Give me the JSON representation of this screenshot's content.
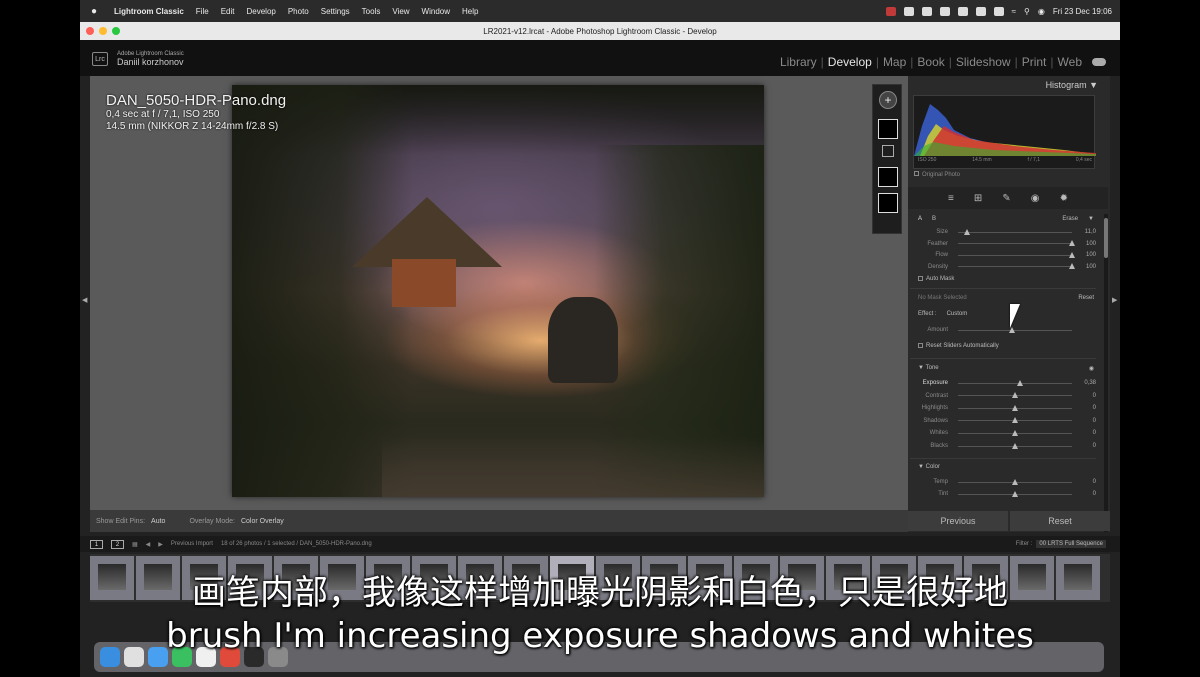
{
  "menubar": {
    "app": "Lightroom Classic",
    "items": [
      "File",
      "Edit",
      "Develop",
      "Photo",
      "Settings",
      "Tools",
      "View",
      "Window",
      "Help"
    ],
    "clock": "Fri 23 Dec  19:06"
  },
  "window": {
    "title": "LR2021-v12.lrcat - Adobe Photoshop Lightroom Classic - Develop"
  },
  "identity": {
    "product": "Adobe Lightroom Classic",
    "user": "Daniil korzhonov",
    "logo": "Lrc"
  },
  "modules": [
    "Library",
    "Develop",
    "Map",
    "Book",
    "Slideshow",
    "Print",
    "Web"
  ],
  "active_module": "Develop",
  "photo": {
    "filename": "DAN_5050-HDR-Pano.dng",
    "exposure": "0,4 sec at f / 7,1, ISO 250",
    "lens": "14.5 mm (NIKKOR Z 14-24mm f/2.8 S)"
  },
  "toolbar": {
    "show_pins_label": "Show Edit Pins:",
    "show_pins_value": "Auto",
    "overlay_label": "Overlay Mode:",
    "overlay_value": "Color Overlay"
  },
  "panel": {
    "histogram_title": "Histogram",
    "histo_labels": [
      "ISO 250",
      "14.5 mm",
      "f / 7,1",
      "0,4 sec"
    ],
    "original_photo": "Original Photo",
    "brush": {
      "tabs": [
        "A",
        "B"
      ],
      "erase": "Erase",
      "sliders": [
        {
          "label": "Size",
          "value": "11,0",
          "pos": 0.08
        },
        {
          "label": "Feather",
          "value": "100",
          "pos": 1.0
        },
        {
          "label": "Flow",
          "value": "100",
          "pos": 1.0
        },
        {
          "label": "Density",
          "value": "100",
          "pos": 1.0
        }
      ],
      "auto_mask": "Auto Mask"
    },
    "mask": {
      "none_selected": "No Mask Selected",
      "reset": "Reset",
      "effect_label": "Effect :",
      "effect_value": "Custom",
      "amount": "Amount",
      "reset_sliders": "Reset Sliders Automatically"
    },
    "tone": {
      "title": "Tone",
      "sliders": [
        {
          "label": "Exposure",
          "value": "0,38",
          "pos": 0.54,
          "bold": true
        },
        {
          "label": "Contrast",
          "value": "0",
          "pos": 0.5
        },
        {
          "label": "Highlights",
          "value": "0",
          "pos": 0.5
        },
        {
          "label": "Shadows",
          "value": "0",
          "pos": 0.5
        },
        {
          "label": "Whites",
          "value": "0",
          "pos": 0.5
        },
        {
          "label": "Blacks",
          "value": "0",
          "pos": 0.5
        }
      ]
    },
    "color": {
      "title": "Color",
      "sliders": [
        {
          "label": "Temp",
          "value": "0",
          "pos": 0.5
        },
        {
          "label": "Tint",
          "value": "0",
          "pos": 0.5
        }
      ]
    },
    "previous": "Previous",
    "reset": "Reset"
  },
  "filmstrip": {
    "pages": [
      "1",
      "2"
    ],
    "source": "Previous Import",
    "count": "18 of 26 photos / 1 selected / DAN_5050-HDR-Pano.dng",
    "filter_label": "Filter :",
    "filter_value": "00 LRTS Full Sequence"
  },
  "subtitles": {
    "zh": "画笔内部，我像这样增加曝光阴影和白色，只是很好地",
    "en": "brush I'm increasing exposure shadows and whites"
  },
  "colors": {
    "accent": "#e6e6e6",
    "panel_bg": "#2a2a2a",
    "workspace_bg": "#5a5a5a"
  }
}
